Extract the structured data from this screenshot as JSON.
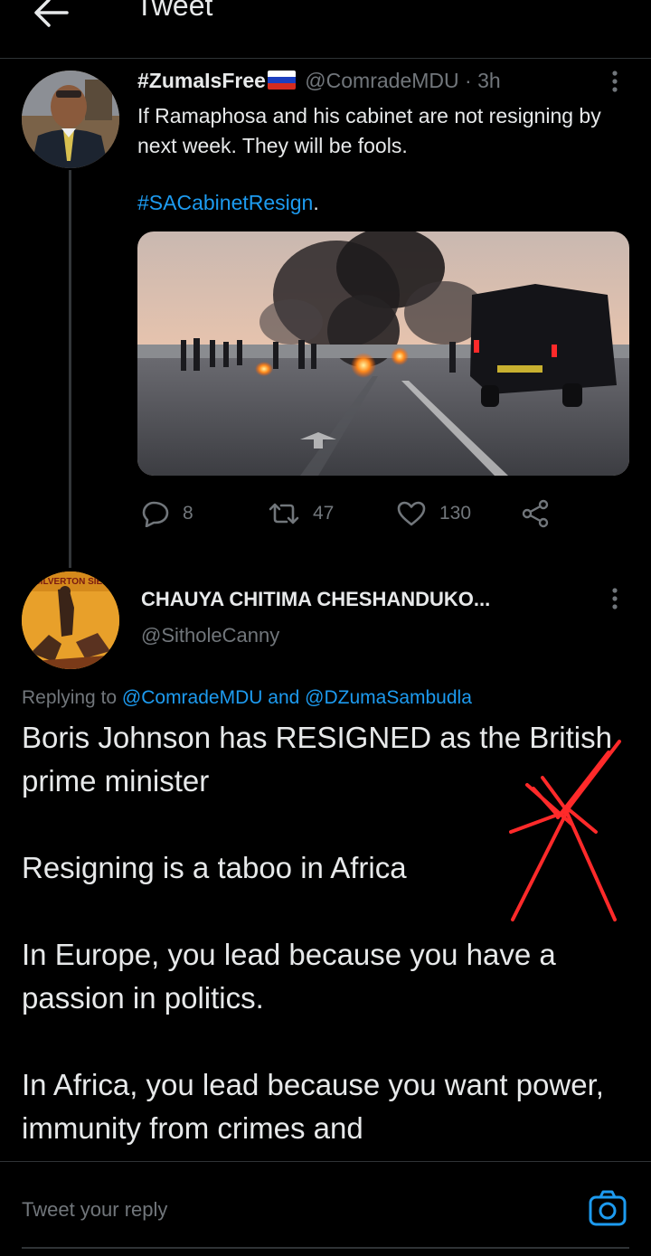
{
  "header": {
    "title": "Tweet"
  },
  "original_tweet": {
    "display_name": "#ZumaIsFree",
    "handle": "@ComradeMDU",
    "separator": "·",
    "time": "3h",
    "text": "If Ramaphosa and his cabinet are not resigning by next week. They will be fools.",
    "hashtag": "#SACabinetResign",
    "hashtag_suffix": ".",
    "counts": {
      "replies": "8",
      "retweets": "47",
      "likes": "130"
    }
  },
  "reply_tweet": {
    "display_name": "CHAUYA CHITIMA CHESHANDUKO...",
    "handle": "@SitholeCanny",
    "avatar_text": "SILVERTON SIE",
    "replying_to_label": "Replying to",
    "replying_to_1": "@ComradeMDU",
    "replying_and": "and",
    "replying_to_2": "@DZumaSambudla",
    "paragraphs": [
      "Boris Johnson has RESIGNED as the British prime minister",
      "Resigning is a taboo in Africa",
      "In Europe, you lead because you have a passion in politics.",
      "In Africa, you lead because you want power, immunity from crimes and"
    ]
  },
  "reply_bar": {
    "placeholder": "Tweet your reply"
  },
  "colors": {
    "accent": "#1d9bf0",
    "background": "#000000",
    "muted": "#71767b",
    "annotation": "#ff2a2a"
  }
}
